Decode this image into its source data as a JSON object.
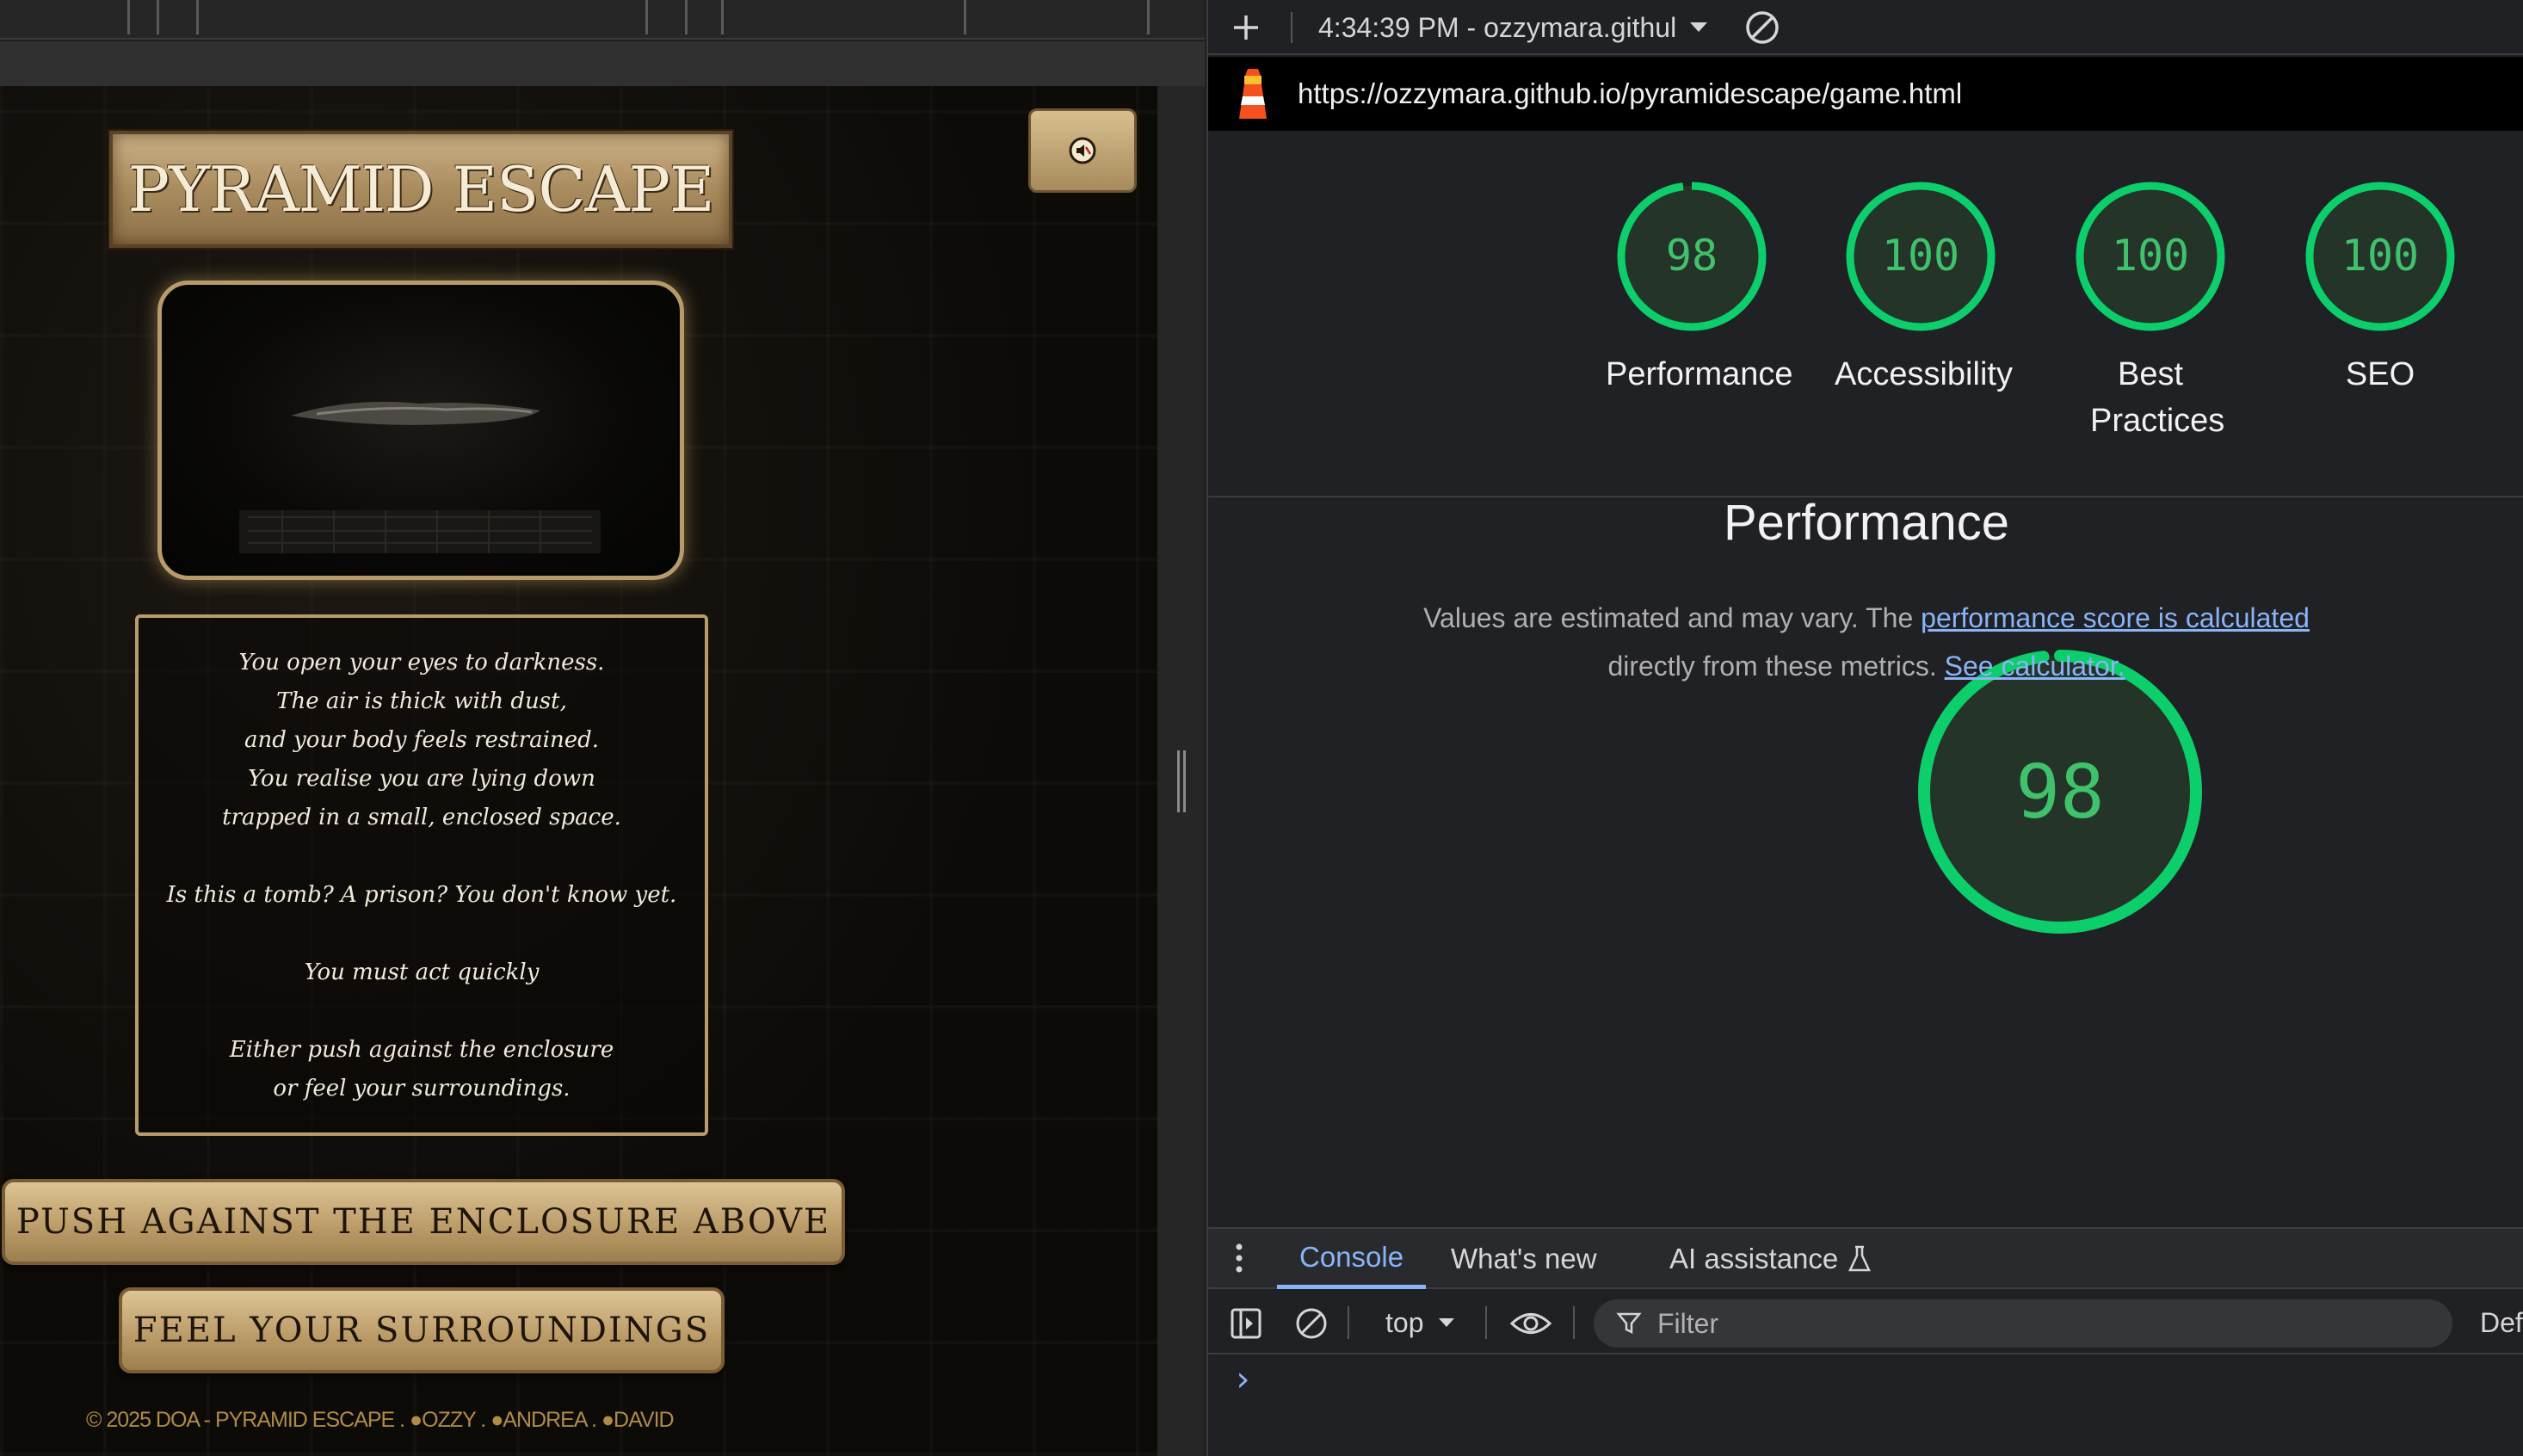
{
  "game": {
    "title": "PYRAMID ESCAPE",
    "mute_icon": "speaker-muted-icon",
    "story_lines": [
      "You open your eyes to darkness.",
      "The air is thick with dust,",
      "and your body feels restrained.",
      "You realise you are lying down",
      "trapped in a small, enclosed space.",
      "",
      "Is this a tomb? A prison? You don't know yet.",
      "",
      "You must act quickly",
      "",
      "Either push against the enclosure",
      "or feel your surroundings."
    ],
    "push_button": "PUSH AGAINST THE ENCLOSURE ABOVE",
    "feel_button": "FEEL YOUR SURROUNDINGS",
    "footer": "© 2025 DOA - PYRAMID ESCAPE . ●OZZY . ●ANDREA . ●DAVID"
  },
  "devtools": {
    "report_selector": "4:34:39 PM - ozzymara.githul",
    "url": "https://ozzymara.github.io/pyramidescape/game.html",
    "scores": [
      {
        "value": "98",
        "label": "Performance",
        "score": 0.98
      },
      {
        "value": "100",
        "label": "Accessibility",
        "score": 1.0
      },
      {
        "value": "100",
        "label": "Best Practices",
        "score": 1.0
      },
      {
        "value": "100",
        "label": "SEO",
        "score": 1.0
      }
    ],
    "big_score": {
      "value": "98",
      "label": "Performance",
      "score": 0.98
    },
    "note_text_1": "Values are estimated and may vary. The ",
    "note_link_1": "performance score is calculated",
    "note_text_2": "directly from these metrics. ",
    "note_link_2": "See calculator.",
    "tabs": [
      "Console",
      "What's new",
      "AI assistance"
    ],
    "context": "top",
    "filter_placeholder": "Filter",
    "levels_partial": "Def",
    "prompt": "›",
    "colors": {
      "pass": "#0cce6b",
      "pass_text": "#3fc26b",
      "ring_bg": "#253429",
      "link": "#8ab4f8"
    }
  }
}
